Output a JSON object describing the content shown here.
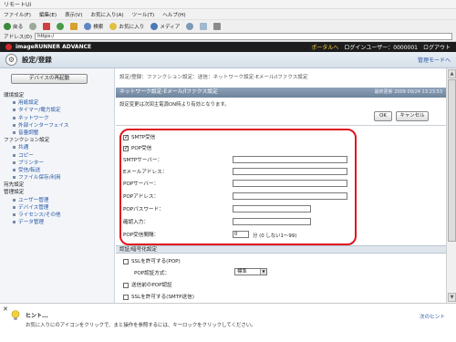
{
  "window": {
    "title": "リモートUI"
  },
  "menubar": [
    "ファイル(F)",
    "編集(E)",
    "表示(V)",
    "お気に入り(A)",
    "ツール(T)",
    "ヘルプ(H)"
  ],
  "toolbar": {
    "back": "戻る",
    "search": "検索",
    "favorites": "お気に入り",
    "media": "メディア"
  },
  "address": {
    "label": "アドレス(D)",
    "value": "https:/"
  },
  "app": {
    "product": "imageRUNNER ADVANCE",
    "portal_link": "ポータルへ",
    "login_user": "ログインユーザー：0000001",
    "logout": "ログアウト",
    "page_title": "設定/登録",
    "mgmt_link": "管理モードへ"
  },
  "sidebar": {
    "restart_button": "デバイスの再起動",
    "items": [
      {
        "label": "環境設定",
        "level": 0
      },
      {
        "label": "用紙設定",
        "level": 1
      },
      {
        "label": "タイマー/電力設定",
        "level": 1
      },
      {
        "label": "ネットワーク",
        "level": 1
      },
      {
        "label": "外部インターフェイス",
        "level": 1
      },
      {
        "label": "音量調整",
        "level": 1
      },
      {
        "label": "ファンクション設定",
        "level": 0
      },
      {
        "label": "共通",
        "level": 1
      },
      {
        "label": "コピー",
        "level": 1
      },
      {
        "label": "プリンター",
        "level": 1
      },
      {
        "label": "送信",
        "level": 1,
        "selected": true
      },
      {
        "label": "受信/転送",
        "level": 1
      },
      {
        "label": "ファイル保存/利用",
        "level": 1
      },
      {
        "label": "宛先設定",
        "level": 0
      },
      {
        "label": "管理設定",
        "level": 0
      },
      {
        "label": "ユーザー管理",
        "level": 1
      },
      {
        "label": "デバイス管理",
        "level": 1
      },
      {
        "label": "ライセンス/その他",
        "level": 1
      },
      {
        "label": "データ管理",
        "level": 1
      }
    ]
  },
  "main": {
    "breadcrumb": "設定/登録：ファンクション設定：送信：ネットワーク設定-Eメール/Iファクス設定",
    "section_title": "ネットワーク設定-Eメール/Iファクス設定",
    "last_updated": "最終更新 2009 09/24 13:23:53",
    "note": "設定変更は次回主電源ON時より有効となります。",
    "ok": "OK",
    "cancel": "キャンセル",
    "smtp_recv": "SMTP受信",
    "pop_recv": "POP受信",
    "fields": [
      {
        "label": "SMTPサーバー：",
        "value": ""
      },
      {
        "label": "Eメールアドレス：",
        "value": ""
      },
      {
        "label": "POPサーバー：",
        "value": ""
      },
      {
        "label": "POPアドレス：",
        "value": ""
      },
      {
        "label": "POPパスワード：",
        "value": ""
      },
      {
        "label": "確認入力：",
        "value": ""
      }
    ],
    "pop_interval_label": "POP受信間隔：",
    "pop_interval_value": "0",
    "pop_interval_unit": "分 (0 しない1〜99)",
    "auth_section": "認証/暗号化設定",
    "ssl_pop": "SSLを許可する(POP)",
    "pop_auth_label": "POP認証方式：",
    "pop_auth_value": "標準",
    "pop_before_smtp": "送信前のPOP認証",
    "ssl_smtp": "SSLを許可する(SMTP送信)"
  },
  "hint": {
    "title": "ヒント...",
    "text": "お気に入りにのアイコンをクリックで、まと操作を参照するには、キーロックをクリックしてください。",
    "next": "次のヒント"
  }
}
